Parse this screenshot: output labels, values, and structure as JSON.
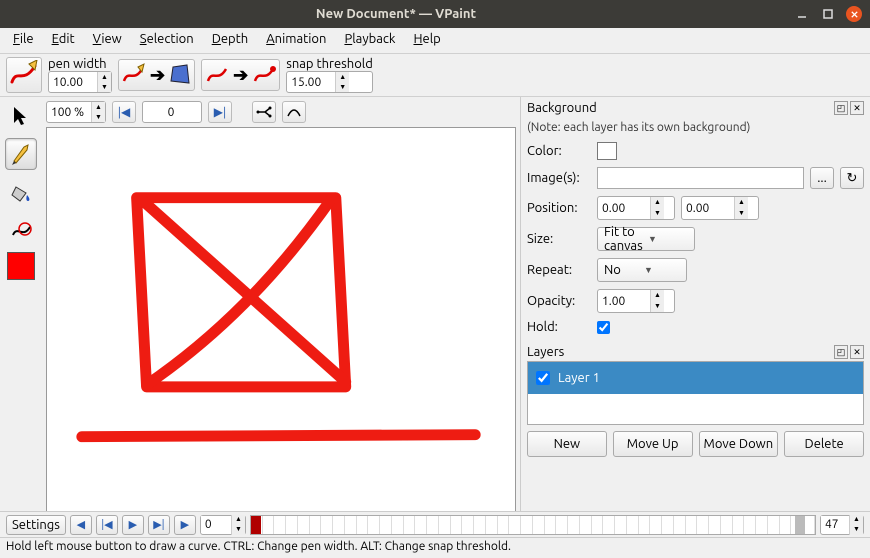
{
  "window": {
    "title": "New Document* — VPaint"
  },
  "menu": [
    "File",
    "Edit",
    "View",
    "Selection",
    "Depth",
    "Animation",
    "Playback",
    "Help"
  ],
  "toolbar": {
    "pen_width_label": "pen width",
    "pen_width_value": "10.00",
    "snap_label": "snap threshold",
    "snap_value": "15.00"
  },
  "canvas_controls": {
    "zoom": "100 %",
    "frame": "0"
  },
  "tools": {
    "selected_color": "#ff0000"
  },
  "background": {
    "heading": "Background",
    "note": "(Note: each layer has its own background)",
    "labels": {
      "color": "Color:",
      "images": "Image(s):",
      "position": "Position:",
      "size": "Size:",
      "repeat": "Repeat:",
      "opacity": "Opacity:",
      "hold": "Hold:"
    },
    "images_value": "",
    "browse": "...",
    "reload_icon": "↻",
    "position_x": "0.00",
    "position_y": "0.00",
    "size_value": "Fit to canvas",
    "repeat_value": "No",
    "opacity_value": "1.00",
    "hold_checked": true
  },
  "layers": {
    "heading": "Layers",
    "items": [
      {
        "name": "Layer 1",
        "visible": true
      }
    ],
    "buttons": {
      "new": "New",
      "moveup": "Move Up",
      "movedown": "Move Down",
      "delete": "Delete"
    }
  },
  "timeline": {
    "settings": "Settings",
    "current": "0",
    "end": "47"
  },
  "statusbar": "Hold left mouse button to draw a curve. CTRL: Change pen width. ALT: Change snap threshold."
}
